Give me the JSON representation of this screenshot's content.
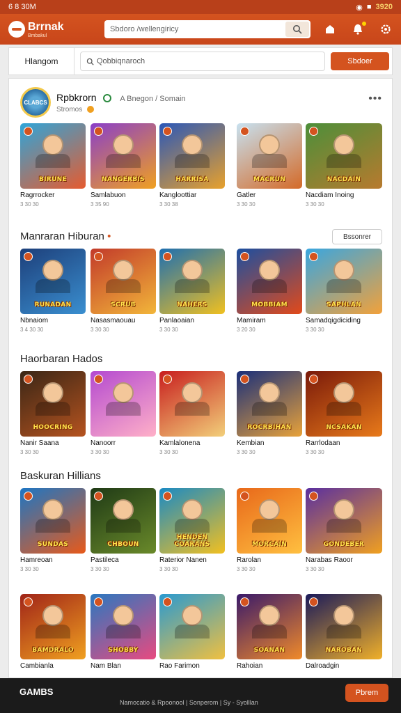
{
  "status": {
    "time": "6 8 30M",
    "battery": "3920"
  },
  "appbar": {
    "logo": "Brrnak",
    "logo_sub": "Bmbakul",
    "search_placeholder": "Sbdoro /wellengiricy",
    "icons": [
      "search-icon",
      "store-icon",
      "bell-icon",
      "settings-icon"
    ]
  },
  "subbar": {
    "home_label": "Hlangom",
    "search_text": "Qobbiqnaroch",
    "subscribe_label": "Sbdoer"
  },
  "profile": {
    "avatar_text": "CLABCS",
    "name": "Rpbkrorn",
    "breadcrumb": "A Bnegon / Somain",
    "subtitle": "Stromos"
  },
  "sections": [
    {
      "title": "",
      "see_all": "",
      "cards": [
        {
          "name": "Ragrrocker",
          "meta": "3 30 30",
          "art": "BIRUNE",
          "c1": "#2fa5d9",
          "c2": "#e65b2f"
        },
        {
          "name": "Samlabuon",
          "meta": "3 35 90",
          "art": "NANGERBIS",
          "c1": "#8a3fc9",
          "c2": "#f0a020"
        },
        {
          "name": "Kangloottiar",
          "meta": "3 30 38",
          "art": "HARRISA",
          "c1": "#2a57b8",
          "c2": "#e8a12c"
        },
        {
          "name": "Gatler",
          "meta": "3 30 30",
          "art": "MACRUN",
          "c1": "#c7e1f0",
          "c2": "#d46a28"
        },
        {
          "name": "Nacdiam Inoing",
          "meta": "3 30 30",
          "art": "NACDAIN",
          "c1": "#4c8f3a",
          "c2": "#b87a2e",
          "wide": true
        }
      ]
    },
    {
      "title": "Manraran Hiburan",
      "see_all": "Bssonrer",
      "cards": [
        {
          "name": "Nbnaiom",
          "meta": "3 4 30 30",
          "art": "RUNADAN",
          "c1": "#1d3f7a",
          "c2": "#3a8fd0"
        },
        {
          "name": "Nasasmaouau",
          "meta": "3 30 30",
          "art": "SCRUB",
          "c1": "#c23a2a",
          "c2": "#f2b63a"
        },
        {
          "name": "Panlaoaian",
          "meta": "3 30 30",
          "art": "NAHERS",
          "c1": "#1e6fb0",
          "c2": "#f0c020"
        },
        {
          "name": "Mamiram",
          "meta": "3 20 30",
          "art": "MOBBIAM",
          "c1": "#1c4fa0",
          "c2": "#e24a1a"
        },
        {
          "name": "Samadqigdiciding",
          "meta": "3 30 30",
          "art": "SAPHLAN",
          "c1": "#39a6e0",
          "c2": "#f2a13a",
          "wide": true
        }
      ]
    },
    {
      "title": "Haorbaran Hados",
      "see_all": "",
      "cards": [
        {
          "name": "Nanir Saana",
          "meta": "3 30 30",
          "art": "HOOCRING",
          "c1": "#3a2616",
          "c2": "#b5531f"
        },
        {
          "name": "Nanoorr",
          "meta": "3 30 30",
          "art": "",
          "c1": "#b44ad0",
          "c2": "#ffb0c8"
        },
        {
          "name": "Kamlalonena",
          "meta": "3 30 30",
          "art": "",
          "c1": "#c81e1e",
          "c2": "#f2cf7a"
        },
        {
          "name": "Kembian",
          "meta": "3 30 30",
          "art": "ROCRBIHAN",
          "c1": "#1a2f7a",
          "c2": "#e8a23a"
        },
        {
          "name": "Rarrlodaan",
          "meta": "3 30 30",
          "art": "NCSAKAN",
          "c1": "#7a1a0a",
          "c2": "#e87a1a",
          "wide": true
        }
      ]
    },
    {
      "title": "Baskuran Hillians",
      "see_all": "",
      "cards": [
        {
          "name": "Hamreoan",
          "meta": "3 30 30",
          "art": "SUNDAS",
          "c1": "#1d76c4",
          "c2": "#e85a1a"
        },
        {
          "name": "Pastileca",
          "meta": "3 30 30",
          "art": "CHBOUN",
          "c1": "#1f3a16",
          "c2": "#6a8a2a"
        },
        {
          "name": "Raterior Nanen",
          "meta": "3 30 30",
          "art": "HENDEN COARANS",
          "c1": "#1a8ac4",
          "c2": "#f2c020"
        },
        {
          "name": "Rarolan",
          "meta": "3 30 30",
          "art": "MORCAIN",
          "c1": "#e8681a",
          "c2": "#ffc040"
        },
        {
          "name": "Narabas Raoor",
          "meta": "3 30 30",
          "art": "GONDEBER",
          "c1": "#5a2fa0",
          "c2": "#f0a020",
          "wide": true
        }
      ]
    },
    {
      "title": "",
      "see_all": "",
      "cards": [
        {
          "name": "Cambianla",
          "meta": "",
          "art": "BAMDRALO",
          "c1": "#a02418",
          "c2": "#f0a020"
        },
        {
          "name": "Nam Blan",
          "meta": "",
          "art": "SHOBBY",
          "c1": "#2a78c0",
          "c2": "#e84a80"
        },
        {
          "name": "Rao Farimon",
          "meta": "",
          "art": "",
          "c1": "#2a9ad0",
          "c2": "#f0c040"
        },
        {
          "name": "Rahoian",
          "meta": "",
          "art": "SOANAN",
          "c1": "#3a1a6a",
          "c2": "#f08a2a"
        },
        {
          "name": "Dalroadgin",
          "meta": "",
          "art": "NAROBAN",
          "c1": "#1a1a5a",
          "c2": "#f0b02a",
          "wide": true
        }
      ]
    }
  ],
  "bottom": {
    "title": "GAMBS",
    "links": "Namocatio & Rpoonool | Sonperom | Sy - Syolllan",
    "button": "Pbrem"
  }
}
